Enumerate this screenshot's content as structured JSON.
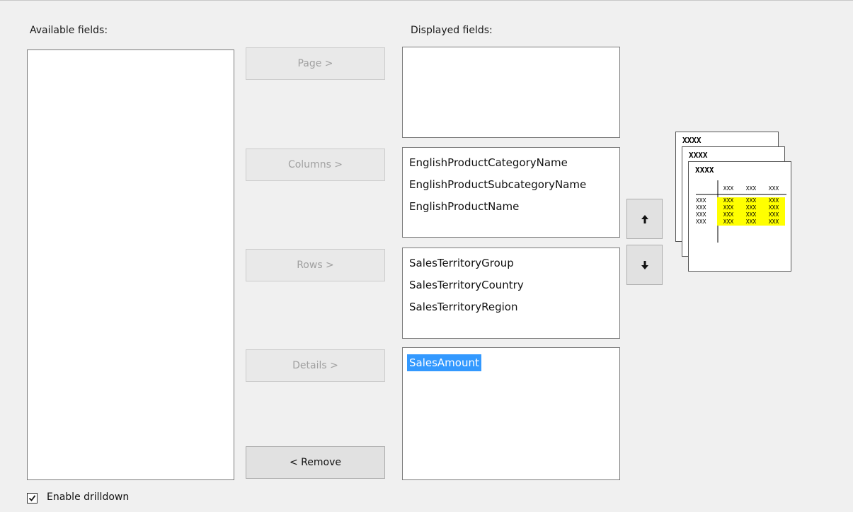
{
  "labels": {
    "available_fields": "Available fields:",
    "displayed_fields": "Displayed fields:"
  },
  "buttons": {
    "page": "Page >",
    "columns": "Columns >",
    "rows": "Rows >",
    "details": "Details >",
    "remove": "< Remove"
  },
  "lists": {
    "available": [],
    "page": [],
    "columns": [
      "EnglishProductCategoryName",
      "EnglishProductSubcategoryName",
      "EnglishProductName"
    ],
    "rows": [
      "SalesTerritoryGroup",
      "SalesTerritoryCountry",
      "SalesTerritoryRegion"
    ],
    "details": [
      "SalesAmount"
    ],
    "details_selected": "SalesAmount"
  },
  "icons": {
    "move_up": "arrow-up-icon",
    "move_down": "arrow-down-icon"
  },
  "checkbox": {
    "label": "Enable drilldown",
    "checked": true
  },
  "preview": {
    "title": "XXXX",
    "cell": "XXX"
  },
  "colors": {
    "selection": "#3399ff",
    "preview_highlight": "#ffff00"
  }
}
